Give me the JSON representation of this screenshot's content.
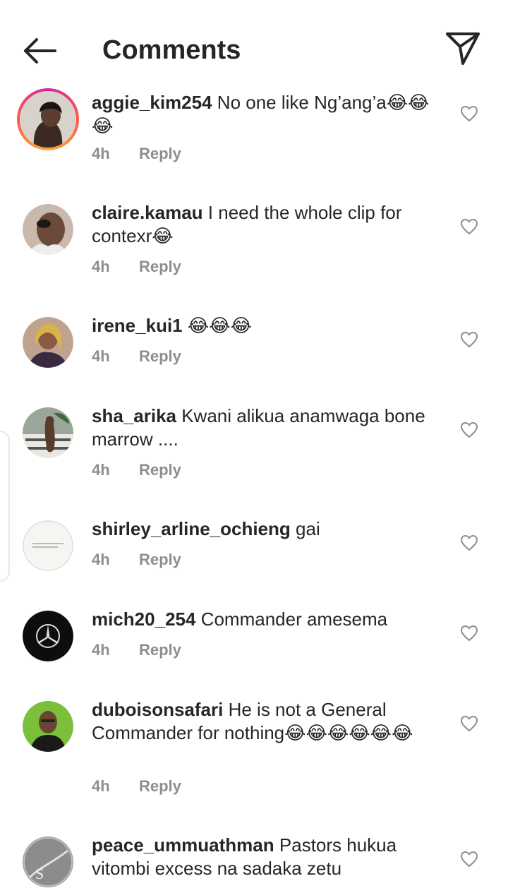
{
  "header": {
    "title": "Comments"
  },
  "icons": {
    "back": "arrow-left-icon",
    "send": "paper-plane-icon",
    "like": "heart-outline-icon"
  },
  "comments": [
    {
      "username": "aggie_kim254",
      "text": "No one like Ng’ang’a😂😂😂",
      "time": "4h",
      "reply": "Reply",
      "has_story": true
    },
    {
      "username": "claire.kamau",
      "text": "I need the whole clip for contexr😂",
      "time": "4h",
      "reply": "Reply",
      "has_story": false
    },
    {
      "username": "irene_kui1",
      "text": "😂😂😂",
      "time": "4h",
      "reply": "Reply",
      "has_story": false
    },
    {
      "username": "sha_arika",
      "text": "Kwani alikua anamwaga bone marrow ....",
      "time": "4h",
      "reply": "Reply",
      "has_story": false
    },
    {
      "username": "shirley_arline_ochieng",
      "text": "gai",
      "time": "4h",
      "reply": "Reply",
      "has_story": false
    },
    {
      "username": "mich20_254",
      "text": "Commander amesema",
      "time": "4h",
      "reply": "Reply",
      "has_story": false
    },
    {
      "username": "duboisonsafari",
      "text": "He is not a General Commander for nothing😂😂😂😂😂😂",
      "time": "4h",
      "reply": "Reply",
      "has_story": false
    },
    {
      "username": "peace_ummuathman",
      "text": "Pastors hukua vitombi excess na sadaka zetu",
      "time": "",
      "reply": "",
      "has_story": false
    }
  ]
}
